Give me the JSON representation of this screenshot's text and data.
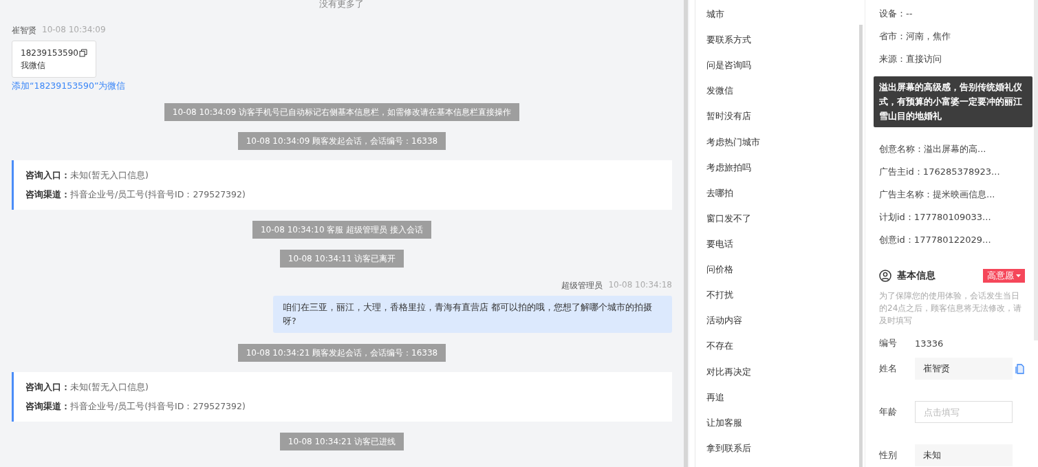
{
  "chat": {
    "items": [
      {
        "kind": "end_note",
        "text": "没有更多了"
      },
      {
        "kind": "visitor_msg",
        "name": "崔智贤",
        "time": "10-08 10:34:09",
        "phone": "18239153590",
        "note": "我微信",
        "link": "添加“18239153590”为微信"
      },
      {
        "kind": "system",
        "text": "10-08 10:34:09 访客手机号已自动标记右侧基本信息栏，如需修改请在基本信息栏直接操作"
      },
      {
        "kind": "system",
        "text": "10-08 10:34:09 顾客发起会话，会话编号：16338"
      },
      {
        "kind": "entry_card",
        "rows": [
          {
            "label": "咨询入口：",
            "value": "未知(暂无入口信息)"
          },
          {
            "label": "咨询渠道：",
            "value": "抖音企业号/员工号(抖音号ID：279527392)"
          }
        ]
      },
      {
        "kind": "system",
        "text": "10-08 10:34:10 客服 超级管理员 接入会话"
      },
      {
        "kind": "system",
        "text": "10-08 10:34:11 访客已离开"
      },
      {
        "kind": "agent_msg",
        "name": "超级管理员",
        "time": "10-08 10:34:18",
        "text": "咱们在三亚，丽江，大理，香格里拉，青海有直营店 都可以拍的哦，您想了解哪个城市的拍摄呀?"
      },
      {
        "kind": "system",
        "text": "10-08 10:34:21 顾客发起会话，会话编号：16338"
      },
      {
        "kind": "entry_card",
        "rows": [
          {
            "label": "咨询入口：",
            "value": "未知(暂无入口信息)"
          },
          {
            "label": "咨询渠道：",
            "value": "抖音企业号/员工号(抖音号ID：279527392)"
          }
        ]
      },
      {
        "kind": "system",
        "text": "10-08 10:34:21 访客已进线"
      }
    ]
  },
  "quick_replies": [
    "城市",
    "要联系方式",
    "问是咨询吗",
    "发微信",
    "暂时没有店",
    "考虑热门城市",
    "考虑旅拍吗",
    "去哪拍",
    "窗口发不了",
    "要电话",
    "问价格",
    "不打扰",
    "活动内容",
    "不存在",
    "对比再决定",
    "再追",
    "让加客服",
    "拿到联系后"
  ],
  "info": {
    "rows": [
      "设备：--",
      "省市：河南，焦作",
      "来源：直接访问",
      "创意名称：溢出屏幕的高...",
      "广告主id：176285378923...",
      "广告主名称：提米映画信息...",
      "计划id：177780109033...",
      "创意id：177780122029..."
    ],
    "tooltip": "溢出屏幕的高级感，告别传统婚礼仪式，有预算的小富婆一定要冲的丽江雪山目的地婚礼",
    "basic": {
      "title": "基本信息",
      "tag": {
        "kind": "high",
        "text": "高意愿"
      },
      "notice": "为了保障您的使用体验，会话发生当日的24点之后，顾客信息将无法修改，请及时填写",
      "fields": [
        {
          "kind": "text",
          "label": "编号",
          "value": "13336"
        },
        {
          "kind": "filled",
          "label": "姓名",
          "value": "崔智贤"
        },
        {
          "kind": "input",
          "label": "年龄",
          "placeholder": "点击填写"
        },
        {
          "kind": "filled",
          "label": "性别",
          "value": "未知"
        }
      ]
    }
  }
}
